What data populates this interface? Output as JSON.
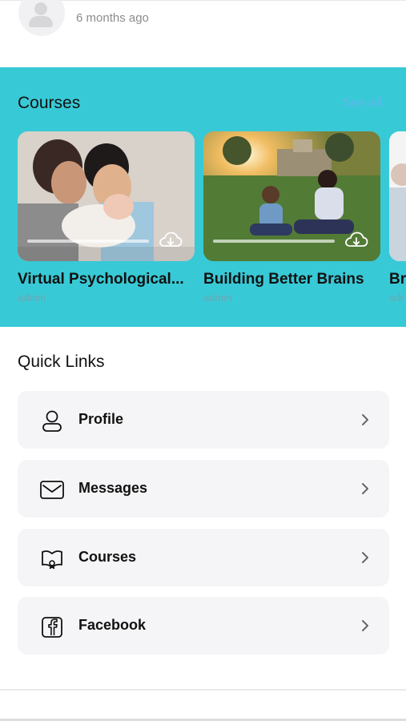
{
  "activity": {
    "timestamp": "6 months ago",
    "avatar_icon": "default-avatar-icon"
  },
  "courses": {
    "title": "Courses",
    "see_all_label": "See all",
    "accent_color": "#38c9d6",
    "items": [
      {
        "title": "Virtual Psychological...",
        "author": "admin",
        "progress": 0,
        "icon": "cloud-download-icon"
      },
      {
        "title": "Building Better Brains",
        "author": "admin",
        "progress": 0,
        "icon": "cloud-download-icon"
      },
      {
        "title": "Br",
        "author": "adr",
        "progress": 0,
        "icon": "cloud-download-icon"
      }
    ]
  },
  "quick_links": {
    "title": "Quick Links",
    "items": [
      {
        "label": "Profile",
        "icon": "user-icon"
      },
      {
        "label": "Messages",
        "icon": "envelope-icon"
      },
      {
        "label": "Courses",
        "icon": "course-book-icon"
      },
      {
        "label": "Facebook",
        "icon": "facebook-icon"
      }
    ]
  }
}
